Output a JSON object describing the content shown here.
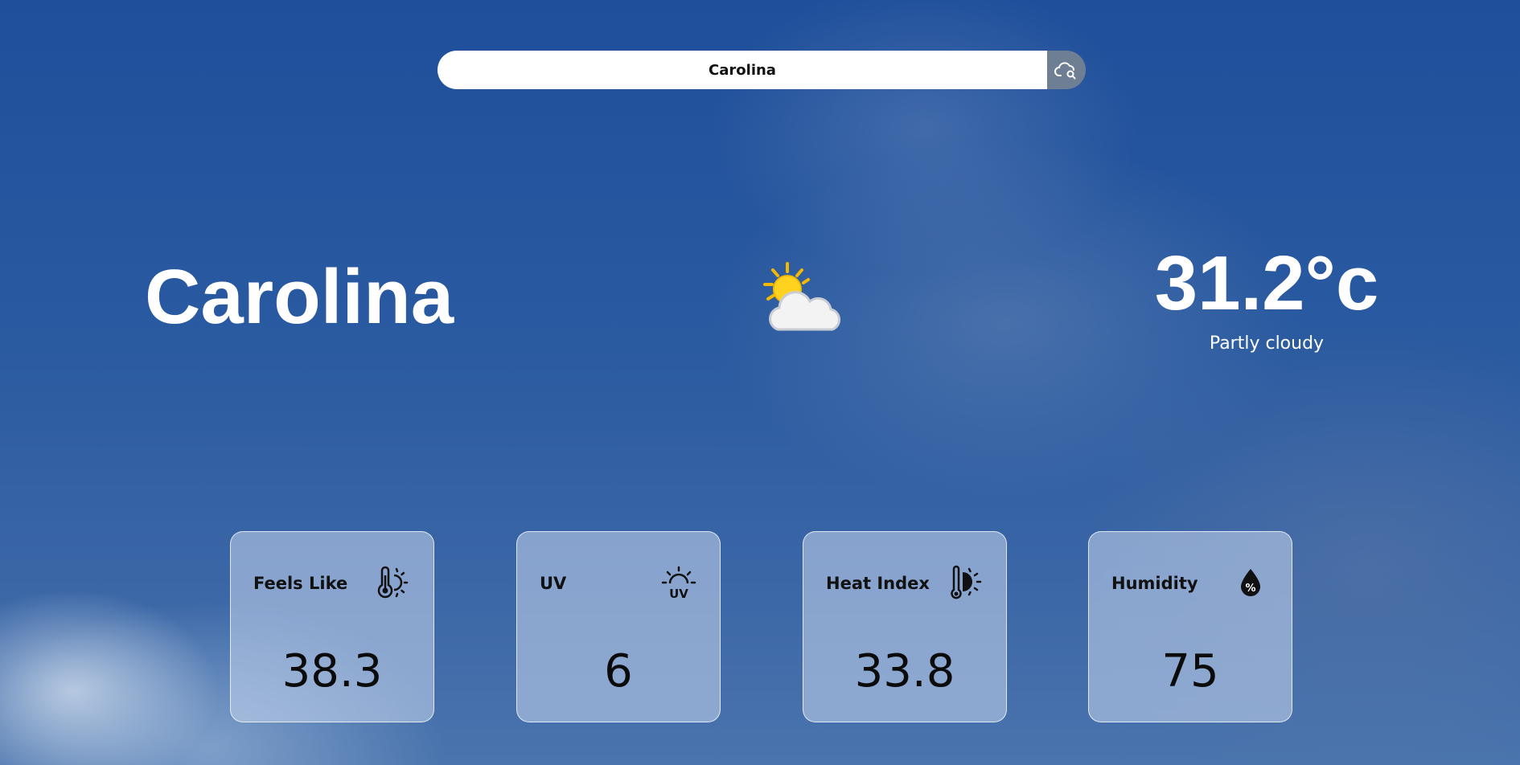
{
  "search": {
    "value": "Carolina",
    "button_icon": "cloud-search-icon"
  },
  "weather": {
    "city": "Carolina",
    "condition_icon": "partly-cloudy-icon",
    "temperature": "31.2°c",
    "condition": "Partly cloudy"
  },
  "cards": [
    {
      "title": "Feels Like",
      "icon": "thermometer-sun-icon",
      "value": "38.3"
    },
    {
      "title": "UV",
      "icon": "uv-sun-icon",
      "value": "6"
    },
    {
      "title": "Heat Index",
      "icon": "heat-thermometer-icon",
      "value": "33.8"
    },
    {
      "title": "Humidity",
      "icon": "humidity-drop-icon",
      "value": "75"
    }
  ],
  "colors": {
    "background": "#2a5aa0",
    "search_button": "#6f7f93",
    "text_light": "#ffffff",
    "card_text": "#111111"
  }
}
